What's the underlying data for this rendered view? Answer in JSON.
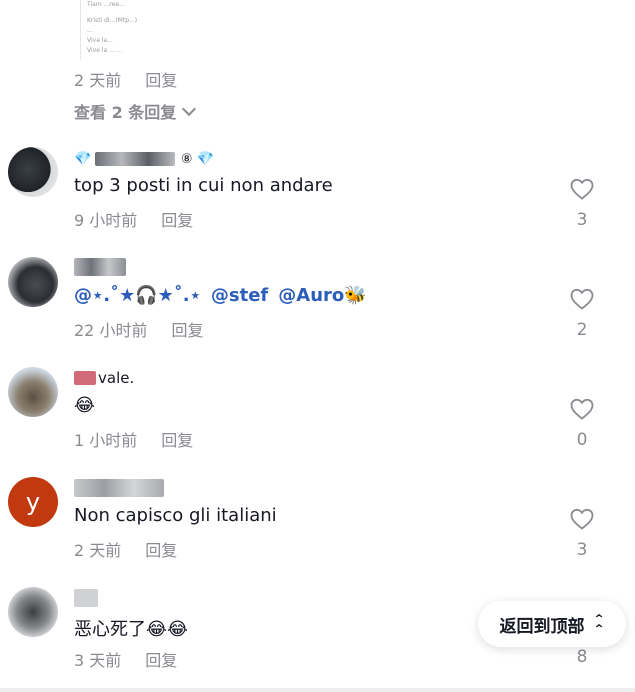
{
  "top_reply": {
    "thumb_lines": [
      "Tiam ...ree...",
      "Kristi di...(Mtp...)",
      "...",
      "Viva la...",
      "Vive la ... ..."
    ],
    "time": "2 天前",
    "reply_label": "回复"
  },
  "view_replies_label": "查看 2 条回复",
  "comments": [
    {
      "username_suffix": "⑧",
      "text": "top 3 posti in cui non andare",
      "time": "9 小时前",
      "reply_label": "回复",
      "likes": "3"
    },
    {
      "text_mentions": [
        "@⋆.˚★🎧★˚.⋆",
        "@stef",
        "@Auro🐝"
      ],
      "time": "22 小时前",
      "reply_label": "回复",
      "likes": "2"
    },
    {
      "username_fragment": "vale.",
      "text": "😂",
      "time": "1 小时前",
      "reply_label": "回复",
      "likes": "0"
    },
    {
      "avatar_letter": "y",
      "text": "Non capisco gli italiani",
      "time": "2 天前",
      "reply_label": "回复",
      "likes": "3"
    },
    {
      "text": "恶心死了😂😂",
      "time": "3 天前",
      "reply_label": "回复",
      "likes": "8"
    }
  ],
  "back_to_top_label": "返回到顶部",
  "colors": {
    "meta_gray": "#8a8b91",
    "mention_blue": "#2b5db9",
    "avatar_y_bg": "#c1390e",
    "text": "#161823"
  }
}
